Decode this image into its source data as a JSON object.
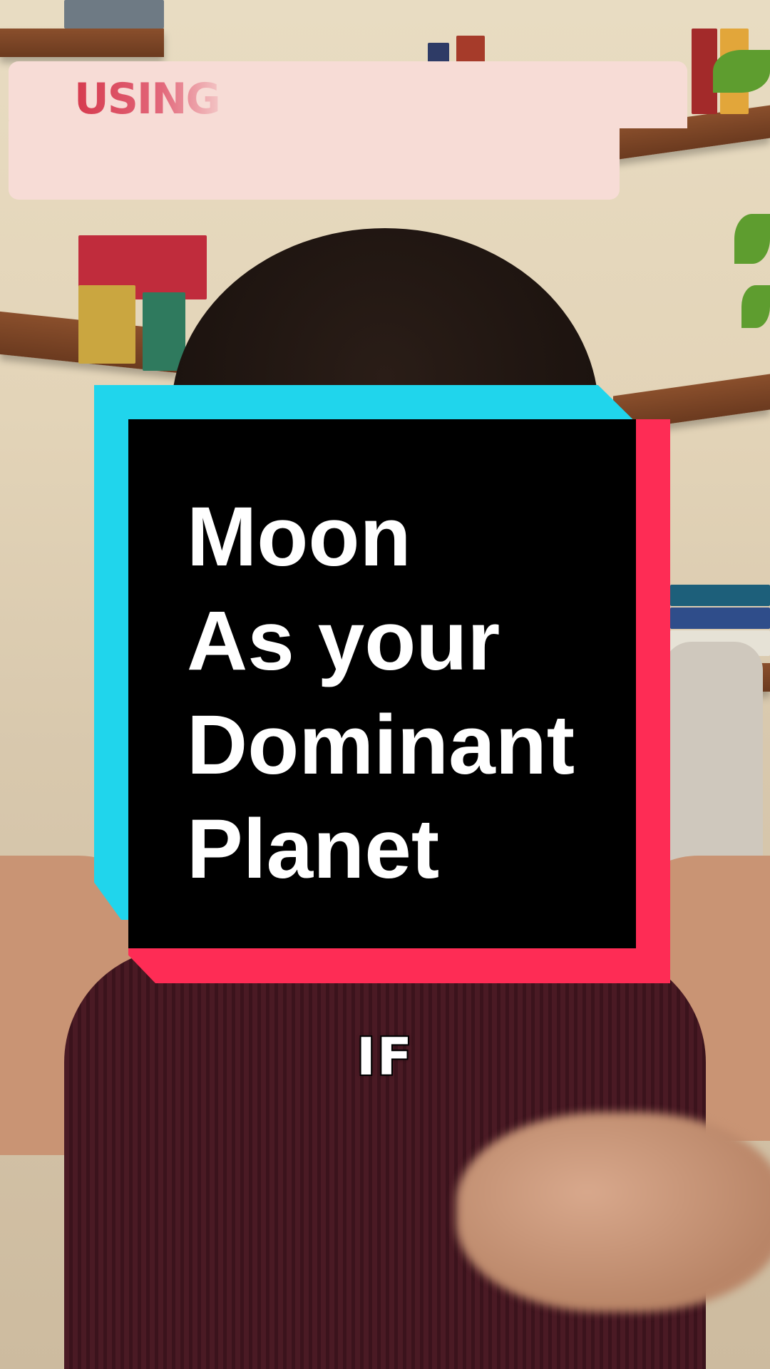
{
  "banner": {
    "text": "USING"
  },
  "title_card": {
    "lines": [
      "Moon",
      "As your",
      "Dominant",
      "Planet"
    ]
  },
  "caption": {
    "text": "IF"
  },
  "colors": {
    "cyan": "#20d5ec",
    "red": "#fe2c55",
    "card_background": "#000000",
    "banner_background": "#f7dcd6",
    "banner_text": "#d84f5f"
  }
}
